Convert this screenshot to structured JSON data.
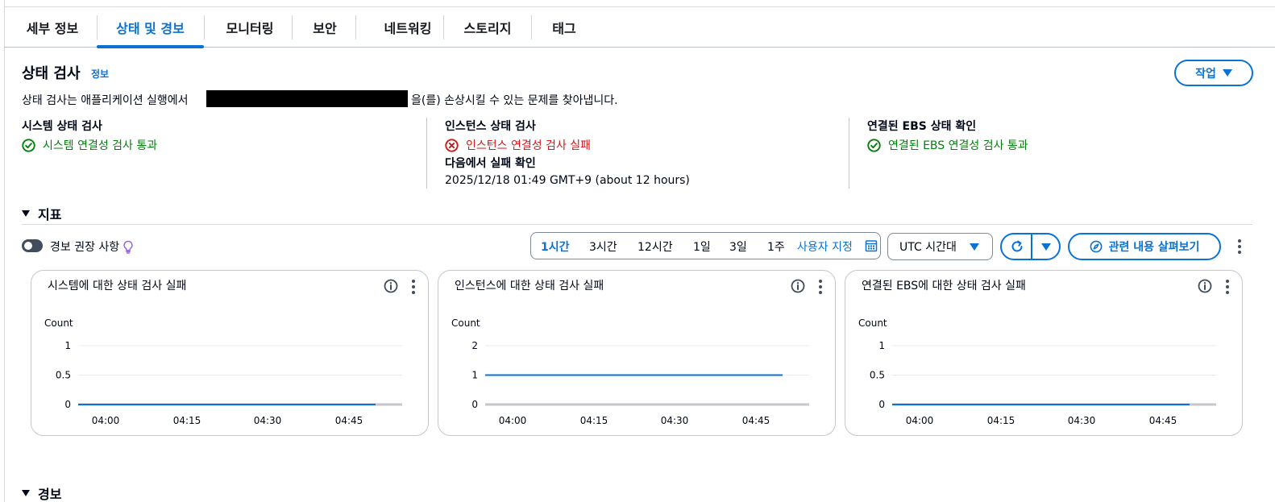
{
  "tabs": [
    {
      "label": "세부 정보",
      "active": false
    },
    {
      "label": "상태 및 경보",
      "active": true
    },
    {
      "label": "모니터링",
      "active": false
    },
    {
      "label": "보안",
      "active": false
    },
    {
      "label": "네트워킹",
      "active": false
    },
    {
      "label": "스토리지",
      "active": false
    },
    {
      "label": "태그",
      "active": false
    }
  ],
  "health": {
    "title": "상태 검사",
    "info_label": "정보",
    "description_before": "상태 검사는 애플리케이션 실행에서",
    "description_after": "을(를) 손상시킬 수 있는 문제를 찾아냅니다.",
    "actions_label": "작업",
    "checks": [
      {
        "label": "시스템 상태 검사",
        "status": "시스템 연결성 검사 통과",
        "state": "ok",
        "icon": "check-circle-icon"
      },
      {
        "label": "인스턴스 상태 검사",
        "status": "인스턴스 연결성 검사 실패",
        "state": "error",
        "icon": "error-circle-icon",
        "sub_label": "다음에서 실패 확인",
        "sub_value": "2025/12/18 01:49 GMT+9 (about 12 hours)"
      },
      {
        "label": "연결된 EBS 상태 확인",
        "status": "연결된 EBS 연결성 검사 통과",
        "state": "ok",
        "icon": "check-circle-icon"
      }
    ]
  },
  "metrics": {
    "title": "지표",
    "alarm_recommendations_label": "경보 권장 사항",
    "time_ranges": [
      {
        "label": "1시간",
        "selected": true
      },
      {
        "label": "3시간",
        "selected": false
      },
      {
        "label": "12시간",
        "selected": false
      },
      {
        "label": "1일",
        "selected": false
      },
      {
        "label": "3일",
        "selected": false
      },
      {
        "label": "1주",
        "selected": false
      }
    ],
    "custom_range_label": "사용자 지정",
    "timezone_label": "UTC 시간대",
    "explore_label": "관련 내용 살펴보기"
  },
  "alarms": {
    "title": "경보"
  },
  "colors": {
    "accent": "#0972d3",
    "success": "#037f0c",
    "error": "#d91515",
    "line": "#0972d3"
  },
  "chart_data": [
    {
      "type": "line",
      "title": "시스템에 대한 상태 검사 실패",
      "ylabel": "Count",
      "ylim": [
        0,
        1
      ],
      "yticks": [
        "1",
        "0.5",
        "0"
      ],
      "xticks": [
        "04:00",
        "04:15",
        "04:30",
        "04:45"
      ],
      "series": [
        {
          "values": [
            0,
            0
          ]
        }
      ]
    },
    {
      "type": "line",
      "title": "인스턴스에 대한 상태 검사 실패",
      "ylabel": "Count",
      "ylim": [
        0,
        2
      ],
      "yticks": [
        "2",
        "1",
        "0"
      ],
      "xticks": [
        "04:00",
        "04:15",
        "04:30",
        "04:45"
      ],
      "series": [
        {
          "values": [
            1,
            1
          ]
        }
      ]
    },
    {
      "type": "line",
      "title": "연결된 EBS에 대한 상태 검사 실패",
      "ylabel": "Count",
      "ylim": [
        0,
        1
      ],
      "yticks": [
        "1",
        "0.5",
        "0"
      ],
      "xticks": [
        "04:00",
        "04:15",
        "04:30",
        "04:45"
      ],
      "series": [
        {
          "values": [
            0,
            0
          ]
        }
      ]
    }
  ]
}
